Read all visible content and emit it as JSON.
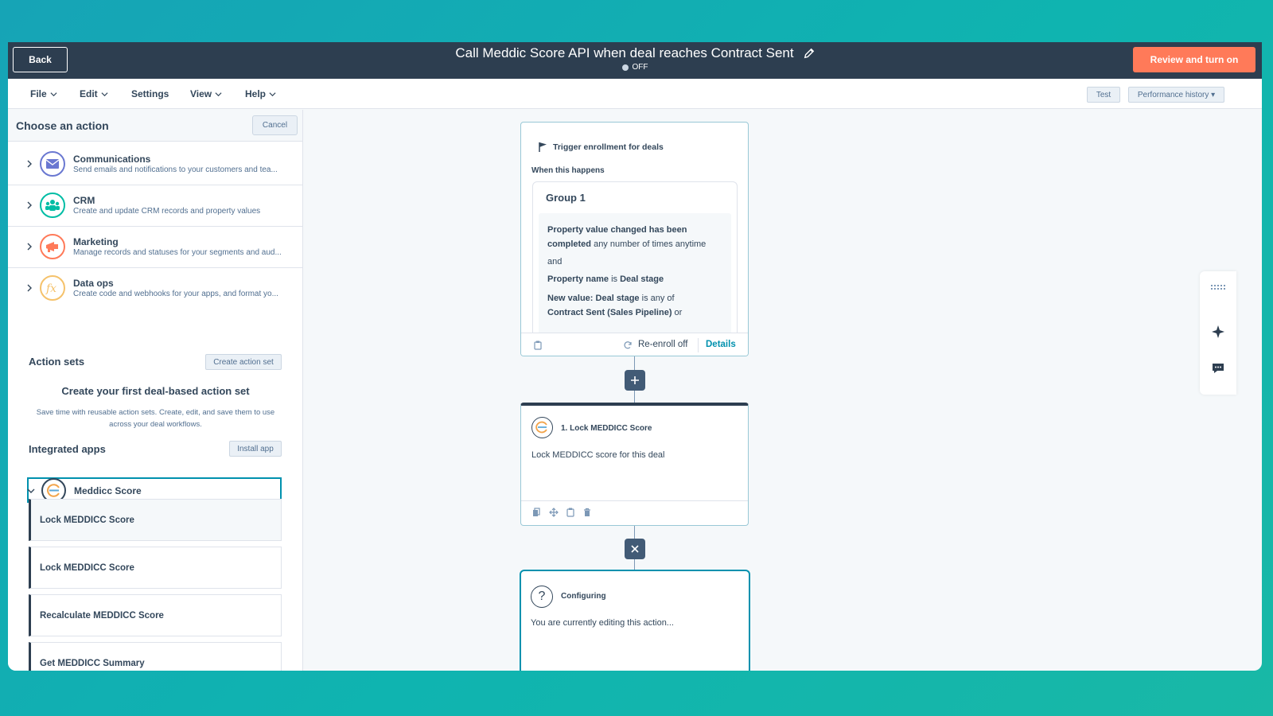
{
  "topbar": {
    "back_label": "Back",
    "title": "Call Meddic Score API when deal reaches Contract Sent",
    "status": "OFF",
    "review_label": "Review and turn on"
  },
  "menubar": {
    "items": [
      {
        "label": "File",
        "has_dropdown": true
      },
      {
        "label": "Edit",
        "has_dropdown": true
      },
      {
        "label": "Settings",
        "has_dropdown": false
      },
      {
        "label": "View",
        "has_dropdown": true
      },
      {
        "label": "Help",
        "has_dropdown": true
      }
    ],
    "test_label": "Test",
    "performance_label": "Performance history ▾"
  },
  "panel": {
    "title": "Choose an action",
    "cancel_label": "Cancel",
    "categories": [
      {
        "name": "Communications",
        "desc": "Send emails and notifications to your customers and tea...",
        "icon": "envelope-icon",
        "color": "#6a78d1"
      },
      {
        "name": "CRM",
        "desc": "Create and update CRM records and property values",
        "icon": "people-icon",
        "color": "#00bda5"
      },
      {
        "name": "Marketing",
        "desc": "Manage records and statuses for your segments and aud...",
        "icon": "megaphone-icon",
        "color": "#ff7a59"
      },
      {
        "name": "Data ops",
        "desc": "Create code and webhooks for your apps, and format yo...",
        "icon": "function-icon",
        "color": "#f5c26b"
      }
    ],
    "action_sets": {
      "title": "Action sets",
      "button": "Create action set",
      "empty_title": "Create your first deal-based action set",
      "empty_desc": "Save time with reusable action sets. Create, edit, and save them to use across your deal workflows."
    },
    "integrated_apps": {
      "title": "Integrated apps",
      "button": "Install app",
      "app_name": "Meddicc Score",
      "actions": [
        "Lock MEDDICC Score",
        "Lock MEDDICC Score",
        "Recalculate MEDDICC Score",
        "Get MEDDICC Summary"
      ]
    }
  },
  "trigger": {
    "title": "Trigger enrollment for deals",
    "subtitle": "When this happens",
    "group": "Group 1",
    "cond1_bold": "Property value changed has been completed",
    "cond1_rest": " any number of times anytime",
    "and": "and",
    "cond2_bold_a": "Property name",
    "cond2_mid": " is ",
    "cond2_bold_b": "Deal stage",
    "cond3_bold_a": "New value: Deal stage",
    "cond3_mid": " is any of",
    "cond3_bold_b": "Contract Sent (Sales Pipeline)",
    "cond3_tail": " or",
    "reenroll": "Re-enroll off",
    "details": "Details"
  },
  "action1": {
    "title": "1. Lock MEDDICC Score",
    "body": "Lock MEDDICC score for this deal"
  },
  "configuring": {
    "title": "Configuring",
    "body": "You are currently editing this action..."
  }
}
